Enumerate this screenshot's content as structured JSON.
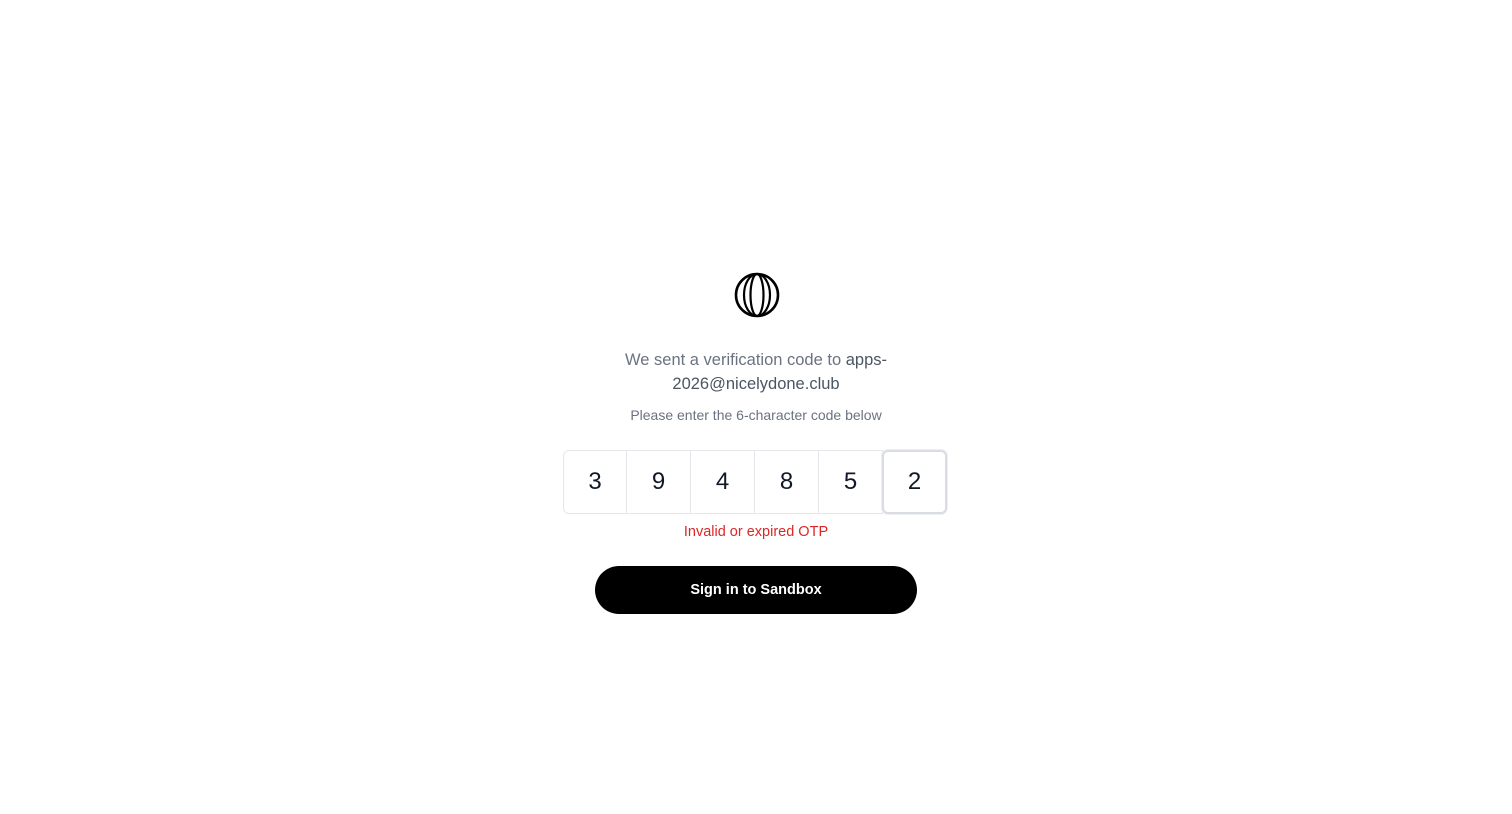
{
  "logo": {
    "icon": "globe-logo-icon"
  },
  "verification": {
    "message_prefix": "We sent a verification code to ",
    "email": "apps-2026@nicelydone.club",
    "instruction": "Please enter the 6-character code below"
  },
  "otp": {
    "digits": [
      "3",
      "9",
      "4",
      "8",
      "5",
      "2"
    ]
  },
  "error": {
    "message": "Invalid or expired OTP",
    "color": "#dc2626"
  },
  "submit": {
    "label": "Sign in to Sandbox",
    "background": "#000000"
  }
}
